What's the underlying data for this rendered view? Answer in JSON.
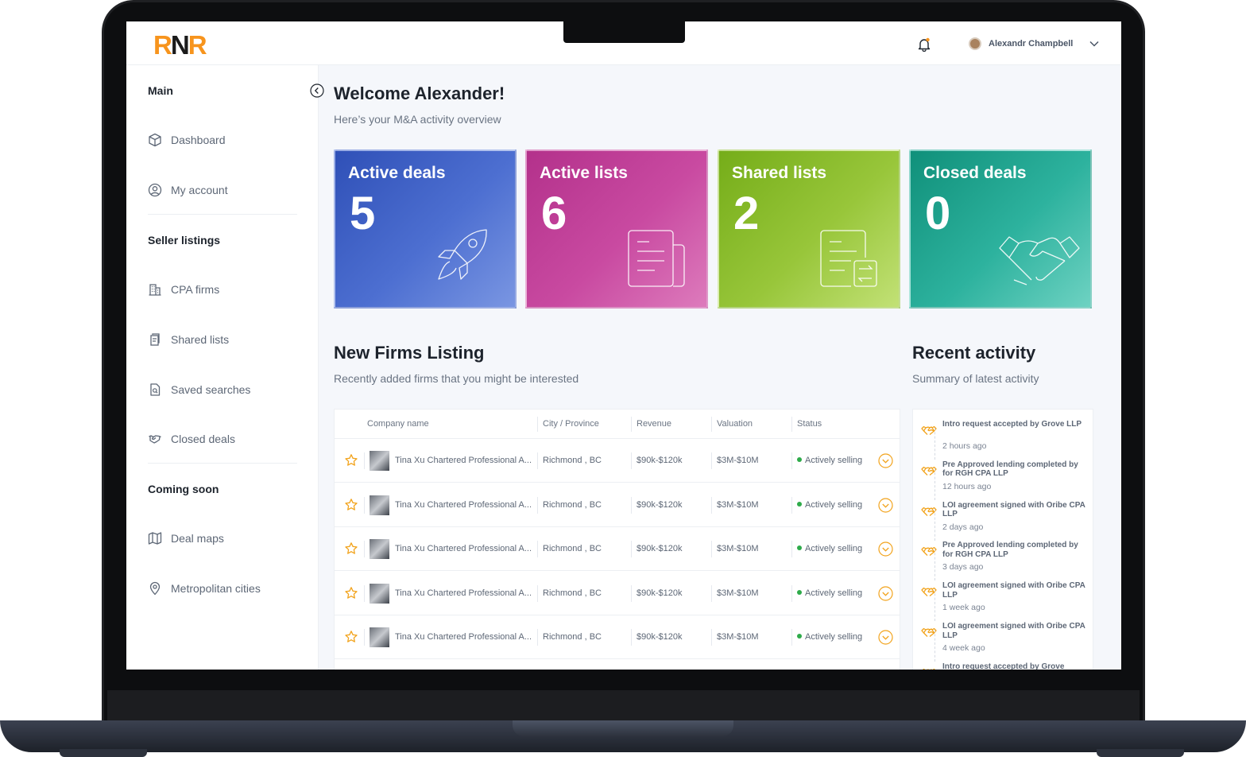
{
  "brand": {
    "logo_left": "R",
    "logo_mid": "N",
    "logo_right": "R",
    "accent": "#f7941d"
  },
  "topbar": {
    "user_name": "Alexandr Champbell"
  },
  "sidebar": {
    "sections": [
      {
        "heading": "Main",
        "items": [
          {
            "label": "Dashboard",
            "icon": "cube-icon"
          },
          {
            "label": "My account",
            "icon": "user-circle-icon"
          }
        ]
      },
      {
        "heading": "Seller listings",
        "items": [
          {
            "label": "CPA firms",
            "icon": "building-icon"
          },
          {
            "label": "Shared lists",
            "icon": "documents-icon"
          },
          {
            "label": "Saved searches",
            "icon": "file-search-icon"
          },
          {
            "label": "Closed deals",
            "icon": "handshake-icon"
          }
        ]
      },
      {
        "heading": "Coming soon",
        "items": [
          {
            "label": "Deal maps",
            "icon": "map-icon"
          },
          {
            "label": "Metropolitan cities",
            "icon": "location-pin-icon"
          }
        ]
      }
    ]
  },
  "main": {
    "title": "Welcome Alexander!",
    "subtitle": "Here’s your M&A activity overview"
  },
  "cards": [
    {
      "title": "Active deals",
      "value": "5",
      "icon": "rocket-icon"
    },
    {
      "title": "Active lists",
      "value": "6",
      "icon": "list-document-icon"
    },
    {
      "title": "Shared lists",
      "value": "2",
      "icon": "shared-document-icon"
    },
    {
      "title": "Closed deals",
      "value": "0",
      "icon": "handshake-icon"
    }
  ],
  "firms": {
    "title": "New Firms Listing",
    "subtitle": "Recently added firms that you might be interested",
    "columns": [
      "Company name",
      "City / Province",
      "Revenue",
      "Valuation",
      "Status"
    ],
    "rows": [
      {
        "company": "Tina Xu Chartered Professional A...",
        "city": "Richmond , BC",
        "revenue": "$90k-$120k",
        "valuation": "$3M-$10M",
        "status": "Actively selling"
      },
      {
        "company": "Tina Xu Chartered Professional A...",
        "city": "Richmond , BC",
        "revenue": "$90k-$120k",
        "valuation": "$3M-$10M",
        "status": "Actively selling"
      },
      {
        "company": "Tina Xu Chartered Professional A...",
        "city": "Richmond , BC",
        "revenue": "$90k-$120k",
        "valuation": "$3M-$10M",
        "status": "Actively selling"
      },
      {
        "company": "Tina Xu Chartered Professional A...",
        "city": "Richmond , BC",
        "revenue": "$90k-$120k",
        "valuation": "$3M-$10M",
        "status": "Actively selling"
      },
      {
        "company": "Tina Xu Chartered Professional A...",
        "city": "Richmond , BC",
        "revenue": "$90k-$120k",
        "valuation": "$3M-$10M",
        "status": "Actively selling"
      }
    ],
    "status_color": "#2eab4a"
  },
  "activity": {
    "title": "Recent activity",
    "subtitle": "Summary of latest activity",
    "items": [
      {
        "text": "Intro request accepted by Grove LLP",
        "time": "2 hours ago"
      },
      {
        "text": "Pre Approved lending completed by for RGH CPA LLP",
        "time": "12 hours ago"
      },
      {
        "text": "LOI agreement signed with Oribe CPA LLP",
        "time": "2 days ago"
      },
      {
        "text": "Pre Approved lending completed by for RGH CPA LLP",
        "time": "3 days ago"
      },
      {
        "text": "LOI agreement signed with Oribe CPA LLP",
        "time": "1 week ago"
      },
      {
        "text": "LOI agreement signed with Oribe CPA LLP",
        "time": "4 week ago"
      },
      {
        "text": "Intro request accepted by Grove",
        "time": ""
      }
    ]
  }
}
